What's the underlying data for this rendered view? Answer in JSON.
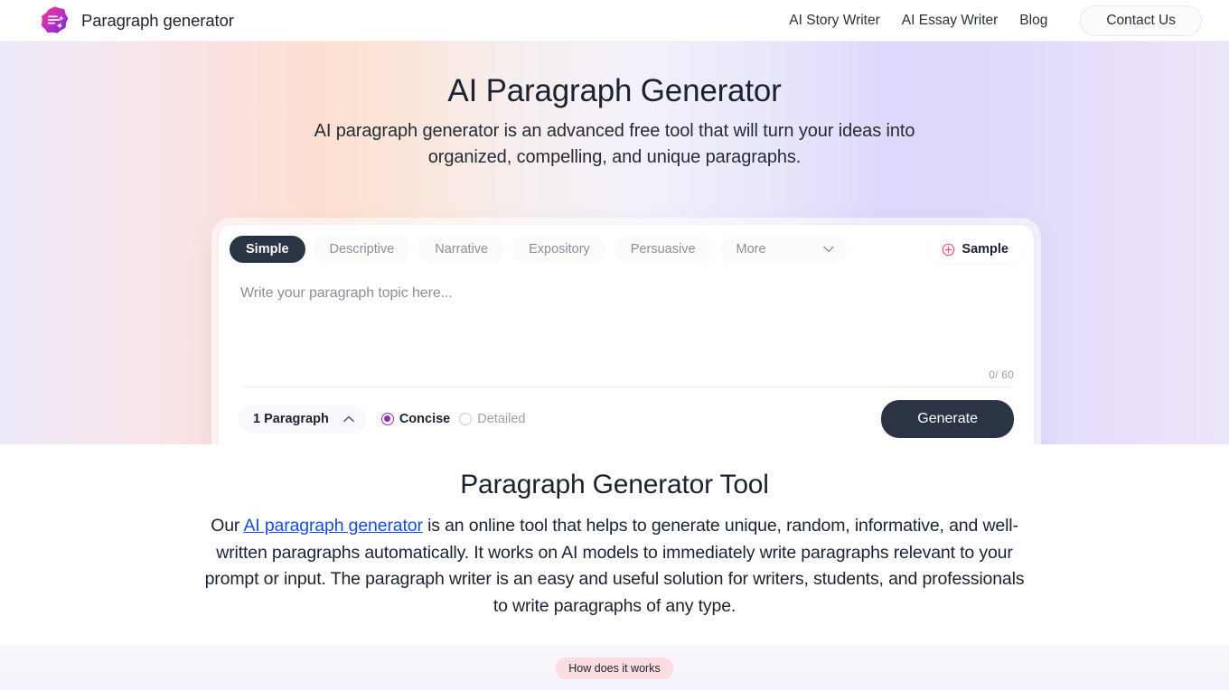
{
  "header": {
    "brand_name": "Paragraph generator",
    "logo_icon": "paragraph-sparkle-logo",
    "nav": [
      {
        "label": "AI Story Writer"
      },
      {
        "label": "AI Essay Writer"
      },
      {
        "label": "Blog"
      }
    ],
    "contact_label": "Contact Us"
  },
  "hero": {
    "title": "AI Paragraph Generator",
    "subtitle": "AI paragraph generator is an advanced free tool that will turn your ideas into organized, compelling, and unique paragraphs."
  },
  "generator": {
    "tabs": [
      {
        "label": "Simple",
        "active": true
      },
      {
        "label": "Descriptive",
        "active": false
      },
      {
        "label": "Narrative",
        "active": false
      },
      {
        "label": "Expository",
        "active": false
      },
      {
        "label": "Persuasive",
        "active": false
      }
    ],
    "more_label": "More",
    "more_icon": "chevron-down-icon",
    "sample_label": "Sample",
    "sample_icon": "circle-plus-icon",
    "editor_placeholder": "Write your paragraph topic here...",
    "editor_value": "",
    "counter": "0/ 60",
    "paragraph_count_label": "1 Paragraph",
    "paragraph_count_icon": "chevron-up-icon",
    "length_options": [
      {
        "label": "Concise",
        "selected": true
      },
      {
        "label": "Detailed",
        "selected": false
      }
    ],
    "generate_label": "Generate"
  },
  "about": {
    "title": "Paragraph Generator Tool",
    "text_before_link": "Our ",
    "link_text": "AI paragraph generator",
    "text_after_link": " is an online tool that helps to generate unique, random, informative, and well-written paragraphs automatically. It works on AI models to immediately write paragraphs relevant to your prompt or input. The paragraph writer is an easy and useful solution for writers, students, and professionals to write paragraphs of any type."
  },
  "footer": {
    "how_badge": "How does it works"
  },
  "colors": {
    "accent_dark": "#2b3445",
    "accent_purple": "#8e2fae",
    "accent_pink": "#e0507a",
    "link_blue": "#1a4ed8",
    "badge_pink": "#fcdde2"
  }
}
